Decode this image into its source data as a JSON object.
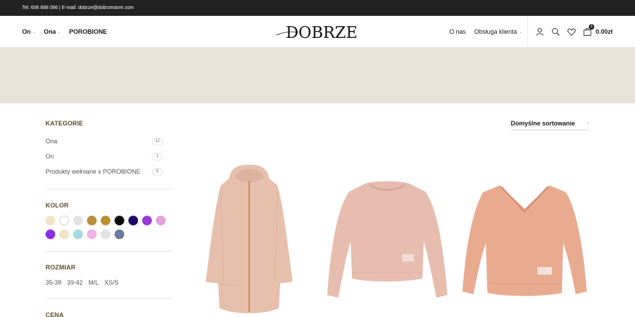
{
  "topbar": {
    "contact": "Tel: 606 888 066 | E-mail: dobrze@dobrzestore.com"
  },
  "header": {
    "logo_text": "DOBRZE",
    "nav_left": [
      {
        "label": "On",
        "has_dropdown": true
      },
      {
        "label": "Ona",
        "has_dropdown": true
      },
      {
        "label": "POROBIONE",
        "has_dropdown": false
      }
    ],
    "nav_right": [
      {
        "label": "O nas",
        "has_dropdown": false
      },
      {
        "label": "Obsługa klienta",
        "has_dropdown": true
      }
    ],
    "icons": [
      "user-icon",
      "search-icon",
      "heart-icon",
      "bag-icon"
    ],
    "cart": {
      "count": "0",
      "total": "0.00zł"
    }
  },
  "sidebar": {
    "categories_title": "KATEGORIE",
    "categories": [
      {
        "label": "Ona",
        "count": "12"
      },
      {
        "label": "On",
        "count": "1"
      },
      {
        "label": "Produkty wełniane x POROBIONE",
        "count": "5"
      }
    ],
    "color_title": "KOLOR",
    "colors": [
      "#efe4c6",
      "#ffffff",
      "#e3e3e6",
      "#b98f3a",
      "#b8922f",
      "#0d0d0d",
      "#1c0a63",
      "#9b39d8",
      "#dfa3dd",
      "#8b2ee6",
      "#efe4c6",
      "#a6d9df",
      "#efb2e2",
      "#e2e2e4",
      "#6b7a9c"
    ],
    "size_title": "ROZMIAR",
    "sizes": [
      "35-38",
      "39-42",
      "M/L",
      "XS/S"
    ],
    "price_title": "CENA"
  },
  "sort": {
    "label": "Domyślne sortowanie"
  },
  "products": [
    {
      "name": "hooded-zip-dress",
      "color": "#e7bfad"
    },
    {
      "name": "crewneck-sweatshirt",
      "color": "#e6bdae"
    },
    {
      "name": "vneck-sweatshirt",
      "color": "#e9ab90"
    }
  ]
}
